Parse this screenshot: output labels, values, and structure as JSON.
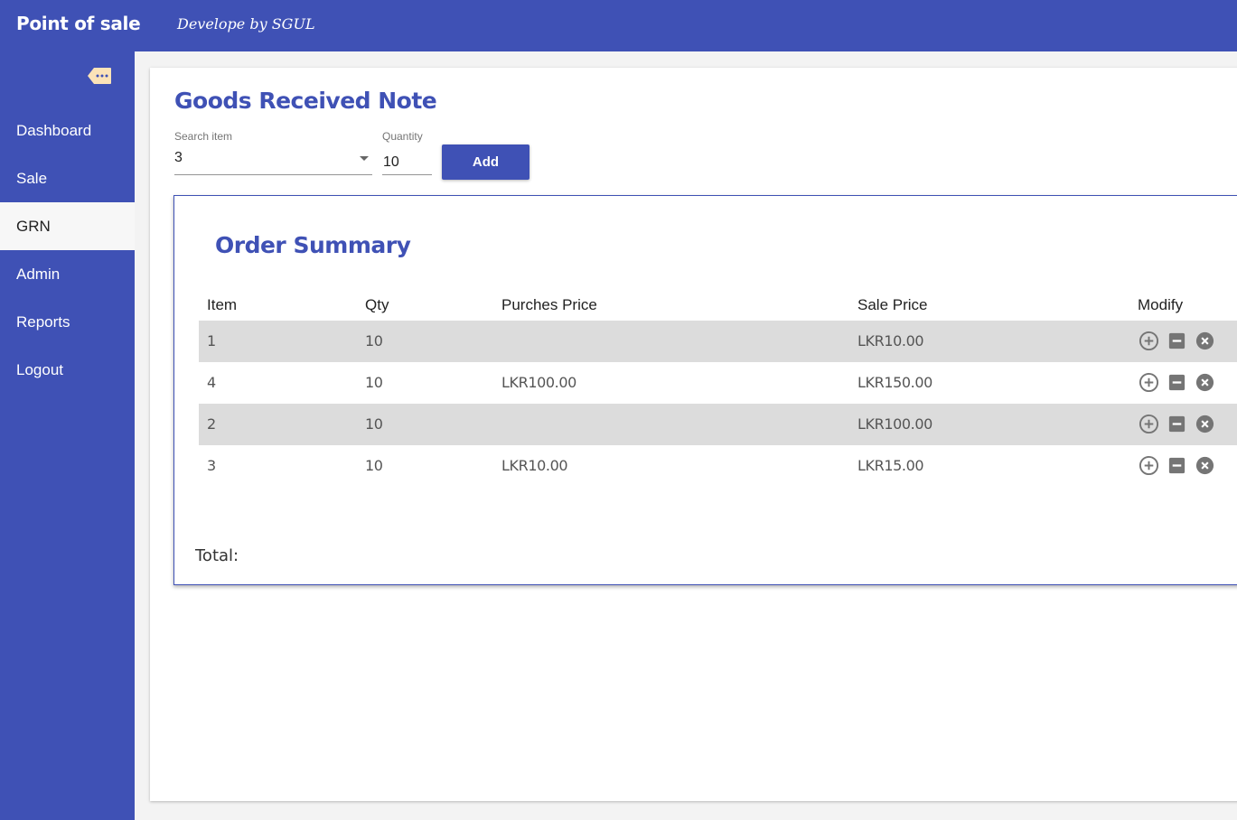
{
  "app": {
    "title": "Point of sale",
    "subtitle": "Develope by SGUL"
  },
  "sidebar": {
    "items": [
      {
        "label": "Dashboard",
        "active": false
      },
      {
        "label": "Sale",
        "active": false
      },
      {
        "label": "GRN",
        "active": true
      },
      {
        "label": "Admin",
        "active": false
      },
      {
        "label": "Reports",
        "active": false
      },
      {
        "label": "Logout",
        "active": false
      }
    ]
  },
  "page": {
    "title": "Goods Received Note"
  },
  "form": {
    "search_label": "Search item",
    "search_value": "3",
    "quantity_label": "Quantity",
    "quantity_value": "10",
    "add_label": "Add"
  },
  "order": {
    "title": "Order Summary",
    "columns": [
      "Item",
      "Qty",
      "Purches Price",
      "Sale Price",
      "Modify"
    ],
    "rows": [
      {
        "item": "1",
        "qty": "10",
        "purchase_price": "",
        "sale_price": "LKR10.00"
      },
      {
        "item": "4",
        "qty": "10",
        "purchase_price": "LKR100.00",
        "sale_price": "LKR150.00"
      },
      {
        "item": "2",
        "qty": "10",
        "purchase_price": "",
        "sale_price": "LKR100.00"
      },
      {
        "item": "3",
        "qty": "10",
        "purchase_price": "LKR10.00",
        "sale_price": "LKR15.00"
      }
    ],
    "total_label": "Total:"
  },
  "colors": {
    "primary": "#3f51b5",
    "row_shade": "#dcdcdc",
    "icon": "#757575"
  }
}
